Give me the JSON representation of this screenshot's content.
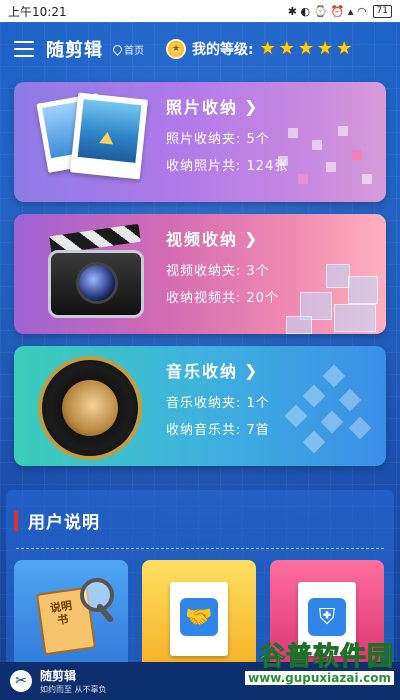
{
  "status_bar": {
    "time": "上午10:21",
    "indicators": "✱ ◐ ⌚ ⏰ ▴ ◠",
    "battery": "71"
  },
  "header": {
    "title": "随剪辑",
    "home_label": "首页",
    "level_label": "我的等级:",
    "stars": 5
  },
  "cards": [
    {
      "title": "照片收纳",
      "line1": "照片收纳夹: 5个",
      "line2": "收纳照片共: 124张"
    },
    {
      "title": "视频收纳",
      "line1": "视频收纳夹: 3个",
      "line2": "收纳视频共: 20个"
    },
    {
      "title": "音乐收纳",
      "line1": "音乐收纳夹: 1个",
      "line2": "收纳音乐共: 7首"
    }
  ],
  "guide": {
    "title": "用户说明",
    "book_label": "说明书"
  },
  "bottom_bar": {
    "app_name": "随剪辑",
    "slogan": "如约而至 从不辜负"
  },
  "watermark": {
    "text": "谷普软件园",
    "url": "www.gupuxiazai.com"
  },
  "colors": {
    "accent_red": "#e02d2d",
    "star_gold": "#ffcc1a",
    "background_blue": "#1d63c9"
  }
}
